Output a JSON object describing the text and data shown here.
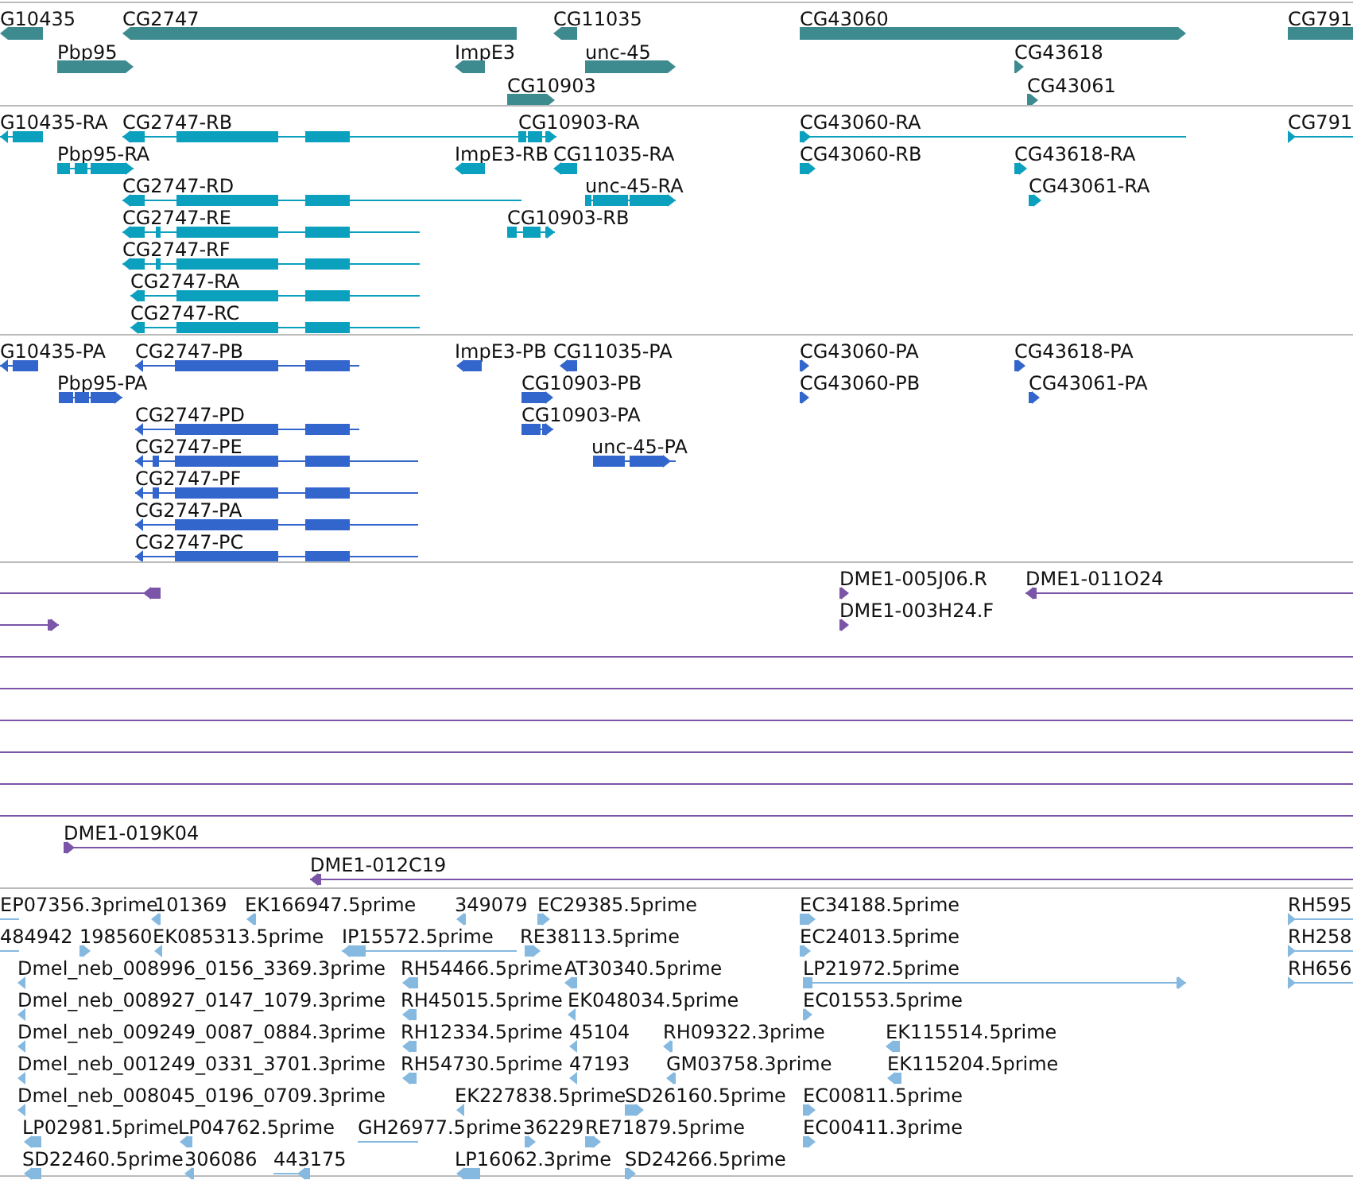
{
  "tracks": [
    {
      "kind": "gene",
      "color": "#3d8b8f",
      "features": [
        {
          "label": "G10435",
          "kind": "reverse"
        },
        {
          "label": "CG2747",
          "kind": "reverse"
        },
        {
          "label": "CG11035",
          "kind": "reverse"
        },
        {
          "label": "CG43060",
          "kind": "forward"
        },
        {
          "label": "CG791",
          "kind": "plain"
        },
        {
          "label": "Pbp95",
          "kind": "forward"
        },
        {
          "label": "ImpE3",
          "kind": "reverse"
        },
        {
          "label": "unc-45",
          "kind": "forward"
        },
        {
          "label": "CG43618",
          "kind": "forward"
        },
        {
          "label": "CG10903",
          "kind": "forward"
        },
        {
          "label": "CG43061",
          "kind": "forward"
        }
      ]
    },
    {
      "kind": "transcript",
      "color": "#0ca0bf",
      "features": [
        {
          "label": "G10435-RA",
          "kind": "reverse"
        },
        {
          "label": "CG2747-RB",
          "kind": "reverse"
        },
        {
          "label": "CG10903-RA",
          "kind": "forward"
        },
        {
          "label": "CG43060-RA",
          "kind": "forward"
        },
        {
          "label": "CG791",
          "kind": "forward"
        },
        {
          "label": "Pbp95-RA",
          "kind": "forward"
        },
        {
          "label": "ImpE3-RB",
          "kind": "reverse"
        },
        {
          "label": "CG11035-RA",
          "kind": "reverse"
        },
        {
          "label": "CG43060-RB",
          "kind": "forward"
        },
        {
          "label": "CG43618-RA",
          "kind": "forward"
        },
        {
          "label": "CG2747-RD",
          "kind": "reverse"
        },
        {
          "label": "unc-45-RA",
          "kind": "forward"
        },
        {
          "label": "CG43061-RA",
          "kind": "forward"
        },
        {
          "label": "CG2747-RE",
          "kind": "reverse"
        },
        {
          "label": "CG10903-RB",
          "kind": "forward"
        },
        {
          "label": "CG2747-RF",
          "kind": "reverse"
        },
        {
          "label": "CG2747-RA",
          "kind": "reverse"
        },
        {
          "label": "CG2747-RC",
          "kind": "reverse"
        }
      ]
    },
    {
      "kind": "protein",
      "color": "#3366cc",
      "features": [
        {
          "label": "G10435-PA",
          "kind": "reverse"
        },
        {
          "label": "CG2747-PB",
          "kind": "reverse"
        },
        {
          "label": "ImpE3-PB",
          "kind": "reverse"
        },
        {
          "label": "CG11035-PA",
          "kind": "reverse"
        },
        {
          "label": "CG43060-PA",
          "kind": "forward"
        },
        {
          "label": "CG43618-PA",
          "kind": "forward"
        },
        {
          "label": "Pbp95-PA",
          "kind": "forward"
        },
        {
          "label": "CG10903-PB",
          "kind": "forward"
        },
        {
          "label": "CG43060-PB",
          "kind": "forward"
        },
        {
          "label": "CG43061-PA",
          "kind": "forward"
        },
        {
          "label": "CG2747-PD",
          "kind": "reverse"
        },
        {
          "label": "CG10903-PA",
          "kind": "forward"
        },
        {
          "label": "CG2747-PE",
          "kind": "reverse"
        },
        {
          "label": "unc-45-PA",
          "kind": "forward"
        },
        {
          "label": "CG2747-PF",
          "kind": "reverse"
        },
        {
          "label": "CG2747-PA",
          "kind": "reverse"
        },
        {
          "label": "CG2747-PC",
          "kind": "reverse"
        }
      ]
    },
    {
      "kind": "clone",
      "color": "#7a55a8",
      "features": [
        {
          "kind": "reverse"
        },
        {
          "label": "DME1-005J06.R",
          "kind": "forward"
        },
        {
          "label": "DME1-011O24",
          "kind": "reverse"
        },
        {
          "kind": "forward"
        },
        {
          "label": "DME1-003H24.F",
          "kind": "forward"
        },
        {
          "kind": "plain"
        },
        {
          "kind": "plain"
        },
        {
          "kind": "plain"
        },
        {
          "kind": "plain"
        },
        {
          "kind": "plain"
        },
        {
          "kind": "plain"
        },
        {
          "label": "DME1-019K04",
          "kind": "forward"
        },
        {
          "label": "DME1-012C19",
          "kind": "reverse"
        }
      ]
    },
    {
      "kind": "est",
      "color": "#85b9e0",
      "features": [
        {
          "label": "EP07356.3prime",
          "kind": "plain"
        },
        {
          "label": "101369",
          "kind": "reverse"
        },
        {
          "label": "EK166947.5prime",
          "kind": "reverse"
        },
        {
          "label": "349079",
          "kind": "reverse"
        },
        {
          "label": "EC29385.5prime",
          "kind": "forward"
        },
        {
          "label": "EC34188.5prime",
          "kind": "forward"
        },
        {
          "label": "RH595",
          "kind": "forward"
        },
        {
          "label": "484942",
          "kind": "plain"
        },
        {
          "label": "198560",
          "kind": "forward"
        },
        {
          "label": "EK085313.5prime",
          "kind": "reverse"
        },
        {
          "label": "IP15572.5prime",
          "kind": "reverse"
        },
        {
          "label": "RE38113.5prime",
          "kind": "forward"
        },
        {
          "label": "EC24013.5prime",
          "kind": "forward"
        },
        {
          "label": "RH258",
          "kind": "forward"
        },
        {
          "label": "Dmel_neb_008996_0156_3369.3prime",
          "kind": "reverse"
        },
        {
          "label": "RH54466.5prime",
          "kind": "reverse"
        },
        {
          "label": "AT30340.5prime",
          "kind": "reverse"
        },
        {
          "label": "LP21972.5prime",
          "kind": "forward"
        },
        {
          "label": "RH656",
          "kind": "forward"
        },
        {
          "label": "Dmel_neb_008927_0147_1079.3prime",
          "kind": "reverse"
        },
        {
          "label": "RH45015.5prime",
          "kind": "reverse"
        },
        {
          "label": "EK048034.5prime",
          "kind": "reverse"
        },
        {
          "label": "EC01553.5prime",
          "kind": "forward"
        },
        {
          "label": "Dmel_neb_009249_0087_0884.3prime",
          "kind": "reverse"
        },
        {
          "label": "RH12334.5prime",
          "kind": "reverse"
        },
        {
          "label": "45104",
          "kind": "reverse"
        },
        {
          "label": "RH09322.3prime",
          "kind": "reverse"
        },
        {
          "label": "EK115514.5prime",
          "kind": "reverse"
        },
        {
          "label": "Dmel_neb_001249_0331_3701.3prime",
          "kind": "reverse"
        },
        {
          "label": "RH54730.5prime",
          "kind": "reverse"
        },
        {
          "label": "47193",
          "kind": "reverse"
        },
        {
          "label": "GM03758.3prime",
          "kind": "reverse"
        },
        {
          "label": "EK115204.5prime",
          "kind": "reverse"
        },
        {
          "label": "Dmel_neb_008045_0196_0709.3prime",
          "kind": "reverse"
        },
        {
          "label": "EK227838.5prime",
          "kind": "reverse"
        },
        {
          "label": "SD26160.5prime",
          "kind": "forward"
        },
        {
          "label": "EC00811.5prime",
          "kind": "forward"
        },
        {
          "label": "LP02981.5prime",
          "kind": "reverse"
        },
        {
          "label": "LP04762.5prime",
          "kind": "reverse"
        },
        {
          "label": "GH26977.5prime",
          "kind": "plain"
        },
        {
          "label": "36229",
          "kind": "forward"
        },
        {
          "label": "RE71879.5prime",
          "kind": "forward"
        },
        {
          "label": "EC00411.3prime",
          "kind": "forward"
        },
        {
          "label": "SD22460.5prime",
          "kind": "reverse"
        },
        {
          "label": "306086",
          "kind": "reverse"
        },
        {
          "label": "443175",
          "kind": "reverse"
        },
        {
          "label": "LP16062.3prime",
          "kind": "reverse"
        },
        {
          "label": "SD24266.5prime",
          "kind": "forward"
        }
      ]
    }
  ]
}
